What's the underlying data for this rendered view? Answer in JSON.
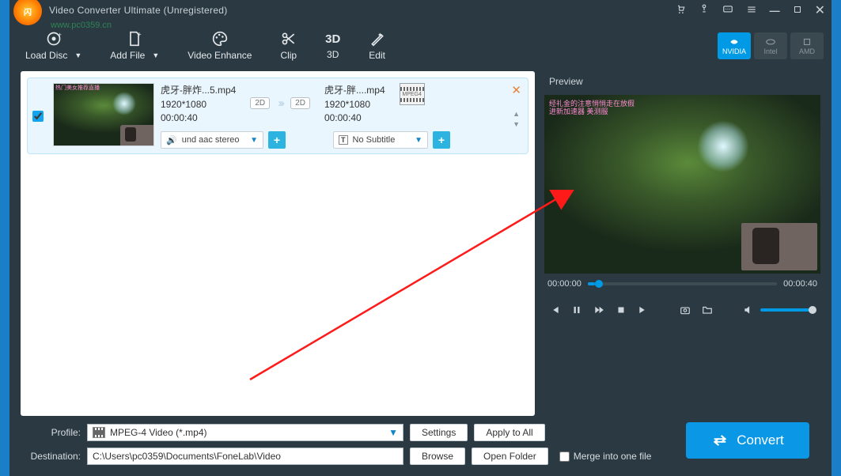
{
  "watermark_url": "www.pc0359.cn",
  "window": {
    "title": "Video Converter Ultimate (Unregistered)"
  },
  "toolbar": {
    "load_disc": "Load Disc",
    "add_file": "Add File",
    "enhance": "Video Enhance",
    "clip": "Clip",
    "three_d": "3D",
    "edit": "Edit"
  },
  "gpu": {
    "nvidia": "NVIDIA",
    "intel": "Intel",
    "amd": "AMD"
  },
  "file": {
    "src_name": "虎牙-胖炸...5.mp4",
    "src_res": "1920*1080",
    "src_dur": "00:00:40",
    "dst_name": "虎牙-胖....mp4",
    "dst_res": "1920*1080",
    "dst_dur": "00:00:40",
    "badge2d": "2D",
    "fmt_label": "MPEG4",
    "audio_sel": "und aac stereo",
    "subtitle_sel": "No Subtitle",
    "thumb_wm": "热门美女推荐直播"
  },
  "preview": {
    "header": "Preview",
    "cur": "00:00:00",
    "total": "00:00:40",
    "video_wm1": "经礼金的注意悄悄走在放假",
    "video_wm2": "进新加速器 美测服"
  },
  "footer": {
    "profile_label": "Profile:",
    "profile_value": "MPEG-4 Video (*.mp4)",
    "settings": "Settings",
    "apply_all": "Apply to All",
    "dest_label": "Destination:",
    "dest_value": "C:\\Users\\pc0359\\Documents\\FoneLab\\Video",
    "browse": "Browse",
    "open_folder": "Open Folder",
    "merge": "Merge into one file",
    "convert": "Convert"
  }
}
